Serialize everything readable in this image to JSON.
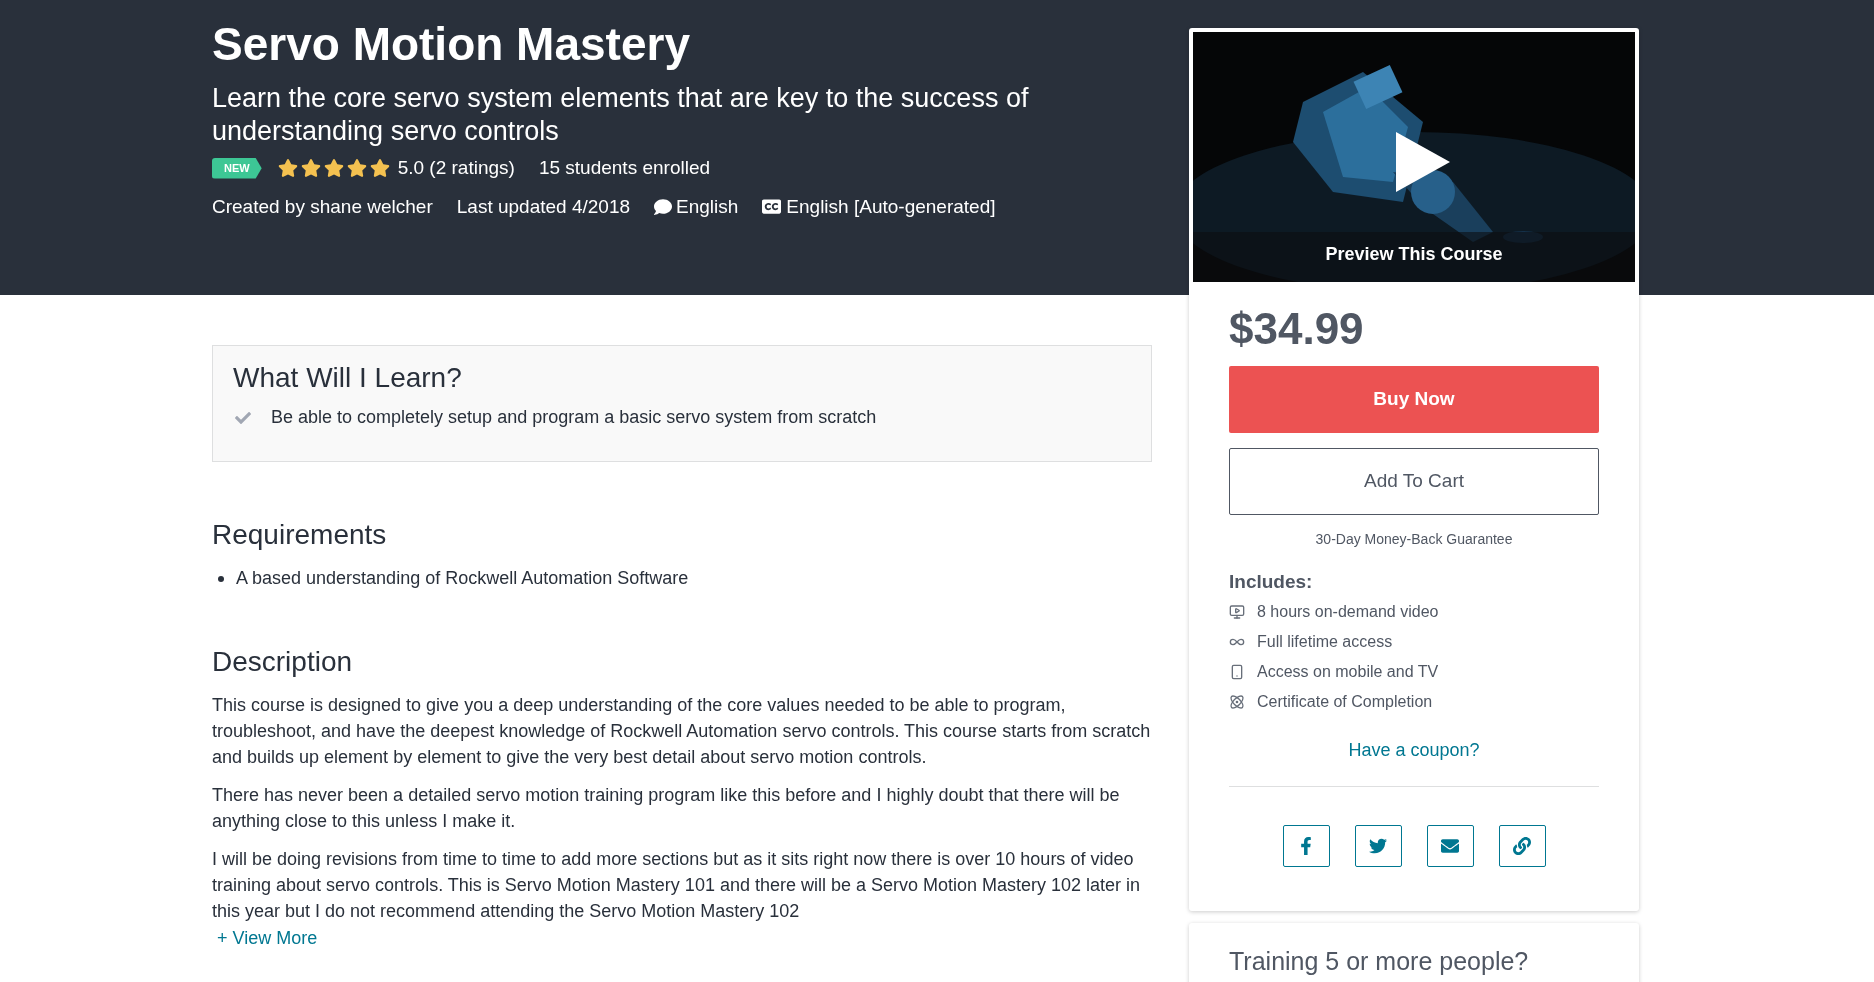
{
  "header": {
    "title": "Servo Motion Mastery",
    "subtitle": "Learn the core servo system elements that are key to the success of understanding servo controls",
    "badge": "NEW",
    "stars": 5,
    "rating": "5.0 (2 ratings)",
    "enrolled": "15 students enrolled",
    "created_by": "Created by shane welcher",
    "last_updated": "Last updated 4/2018",
    "language": "English",
    "captions": "English [Auto-generated]"
  },
  "learn": {
    "heading": "What Will I Learn?",
    "items": [
      "Be able to completely setup and program a basic servo system from scratch"
    ]
  },
  "requirements": {
    "heading": "Requirements",
    "items": [
      "A based understanding of Rockwell Automation Software"
    ]
  },
  "description": {
    "heading": "Description",
    "paragraphs": [
      "This course is designed to give you a deep understanding of the core values needed to be able to program, troubleshoot, and have the deepest knowledge of Rockwell Automation servo controls. This course starts from scratch and builds up element by element to give the very best detail about servo motion controls.",
      "There has never been a detailed servo motion training program like this before and I highly doubt that there will be anything close to this unless I make it.",
      "I will be doing revisions from time to time to add more sections but as it sits right now there is over 10 hours of video training about servo controls. This is Servo Motion Mastery 101 and there will be a Servo Motion Mastery 102 later in this year but I do not recommend attending the Servo Motion Mastery 102"
    ],
    "view_more": "+ View More"
  },
  "sidebar": {
    "preview_label": "Preview This Course",
    "price": "$34.99",
    "buy": "Buy Now",
    "add_to_cart": "Add To Cart",
    "guarantee": "30-Day Money-Back Guarantee",
    "includes_heading": "Includes:",
    "includes": [
      {
        "kind": "video",
        "text": "8 hours on-demand video"
      },
      {
        "kind": "lifetime",
        "text": "Full lifetime access"
      },
      {
        "kind": "mobile",
        "text": "Access on mobile and TV"
      },
      {
        "kind": "certificate",
        "text": "Certificate of Completion"
      }
    ],
    "coupon": "Have a coupon?",
    "share": [
      {
        "kind": "facebook"
      },
      {
        "kind": "twitter"
      },
      {
        "kind": "email"
      },
      {
        "kind": "link"
      }
    ]
  },
  "training": {
    "heading": "Training 5 or more people?"
  }
}
